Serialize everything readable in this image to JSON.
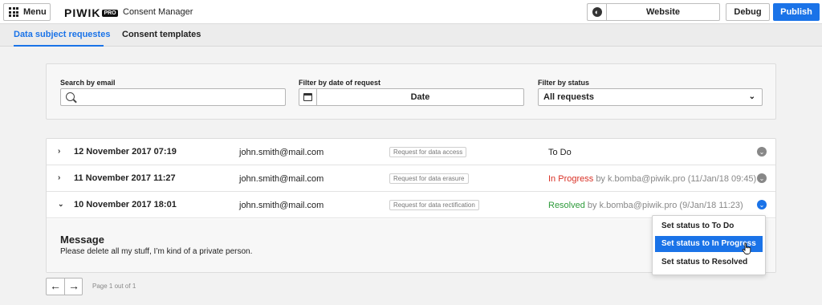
{
  "topbar": {
    "menu_label": "Menu",
    "logo_text": "PIWIK",
    "logo_badge": "PRO",
    "product": "Consent Manager",
    "website": "Website",
    "debug": "Debug",
    "publish": "Publish"
  },
  "tabs": [
    {
      "label": "Data subject requestes",
      "active": true
    },
    {
      "label": "Consent templates",
      "active": false
    }
  ],
  "filters": {
    "email_label": "Search by email",
    "email_value": "",
    "date_label": "Filter by date of request",
    "date_value": "Date",
    "status_label": "Filter by status",
    "status_value": "All requests"
  },
  "rows": [
    {
      "date": "12 November 2017 07:19",
      "email": "john.smith@mail.com",
      "type": "Request for data access",
      "status": "To Do",
      "by": ""
    },
    {
      "date": "11 November 2017 11:27",
      "email": "john.smith@mail.com",
      "type": "Request for data erasure",
      "status": "In Progress",
      "by": "by k.bomba@piwik.pro (11/Jan/18 09:45)"
    },
    {
      "date": "10 November 2017 18:01",
      "email": "john.smith@mail.com",
      "type": "Request for data rectification",
      "status": "Resolved",
      "by": "by k.bomba@piwik.pro (9/Jan/18 11:23)"
    }
  ],
  "message": {
    "title": "Message",
    "body": "Please delete all my stuff, I’m kind of a private person."
  },
  "status_menu": [
    {
      "label": "Set status to To Do"
    },
    {
      "label": "Set status to In Progress",
      "highlighted": true
    },
    {
      "label": "Set status to Resolved"
    }
  ],
  "pager": {
    "prev": "←",
    "next": "→",
    "info": "Page 1 out of 1"
  },
  "colors": {
    "accent": "#1a73e8",
    "in_progress": "#d93025",
    "resolved": "#2e9b3b"
  }
}
